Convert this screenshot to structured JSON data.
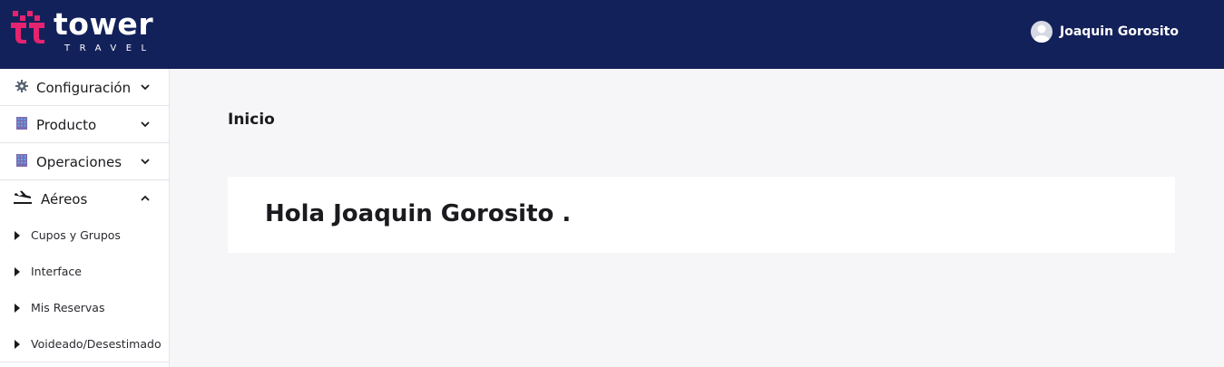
{
  "header": {
    "logo_word": "tower",
    "logo_sub": "TRAVEL",
    "user_name": "Joaquin Gorosito",
    "bg_color": "#13215a",
    "brand_color": "#e5236f"
  },
  "sidebar": {
    "items": [
      {
        "label": "Configuración",
        "icon": "gear-icon",
        "state": "collapsed"
      },
      {
        "label": "Producto",
        "icon": "building-icon",
        "state": "collapsed"
      },
      {
        "label": "Operaciones",
        "icon": "building-icon",
        "state": "collapsed"
      },
      {
        "label": "Aéreos",
        "icon": "plane-landing-icon",
        "state": "expanded"
      }
    ],
    "subitems": [
      {
        "label": "Cupos y Grupos"
      },
      {
        "label": "Interface"
      },
      {
        "label": "Mis Reservas"
      },
      {
        "label": "Voideado/Desestimado"
      }
    ]
  },
  "main": {
    "title": "Inicio",
    "greeting": "Hola Joaquin Gorosito ."
  }
}
